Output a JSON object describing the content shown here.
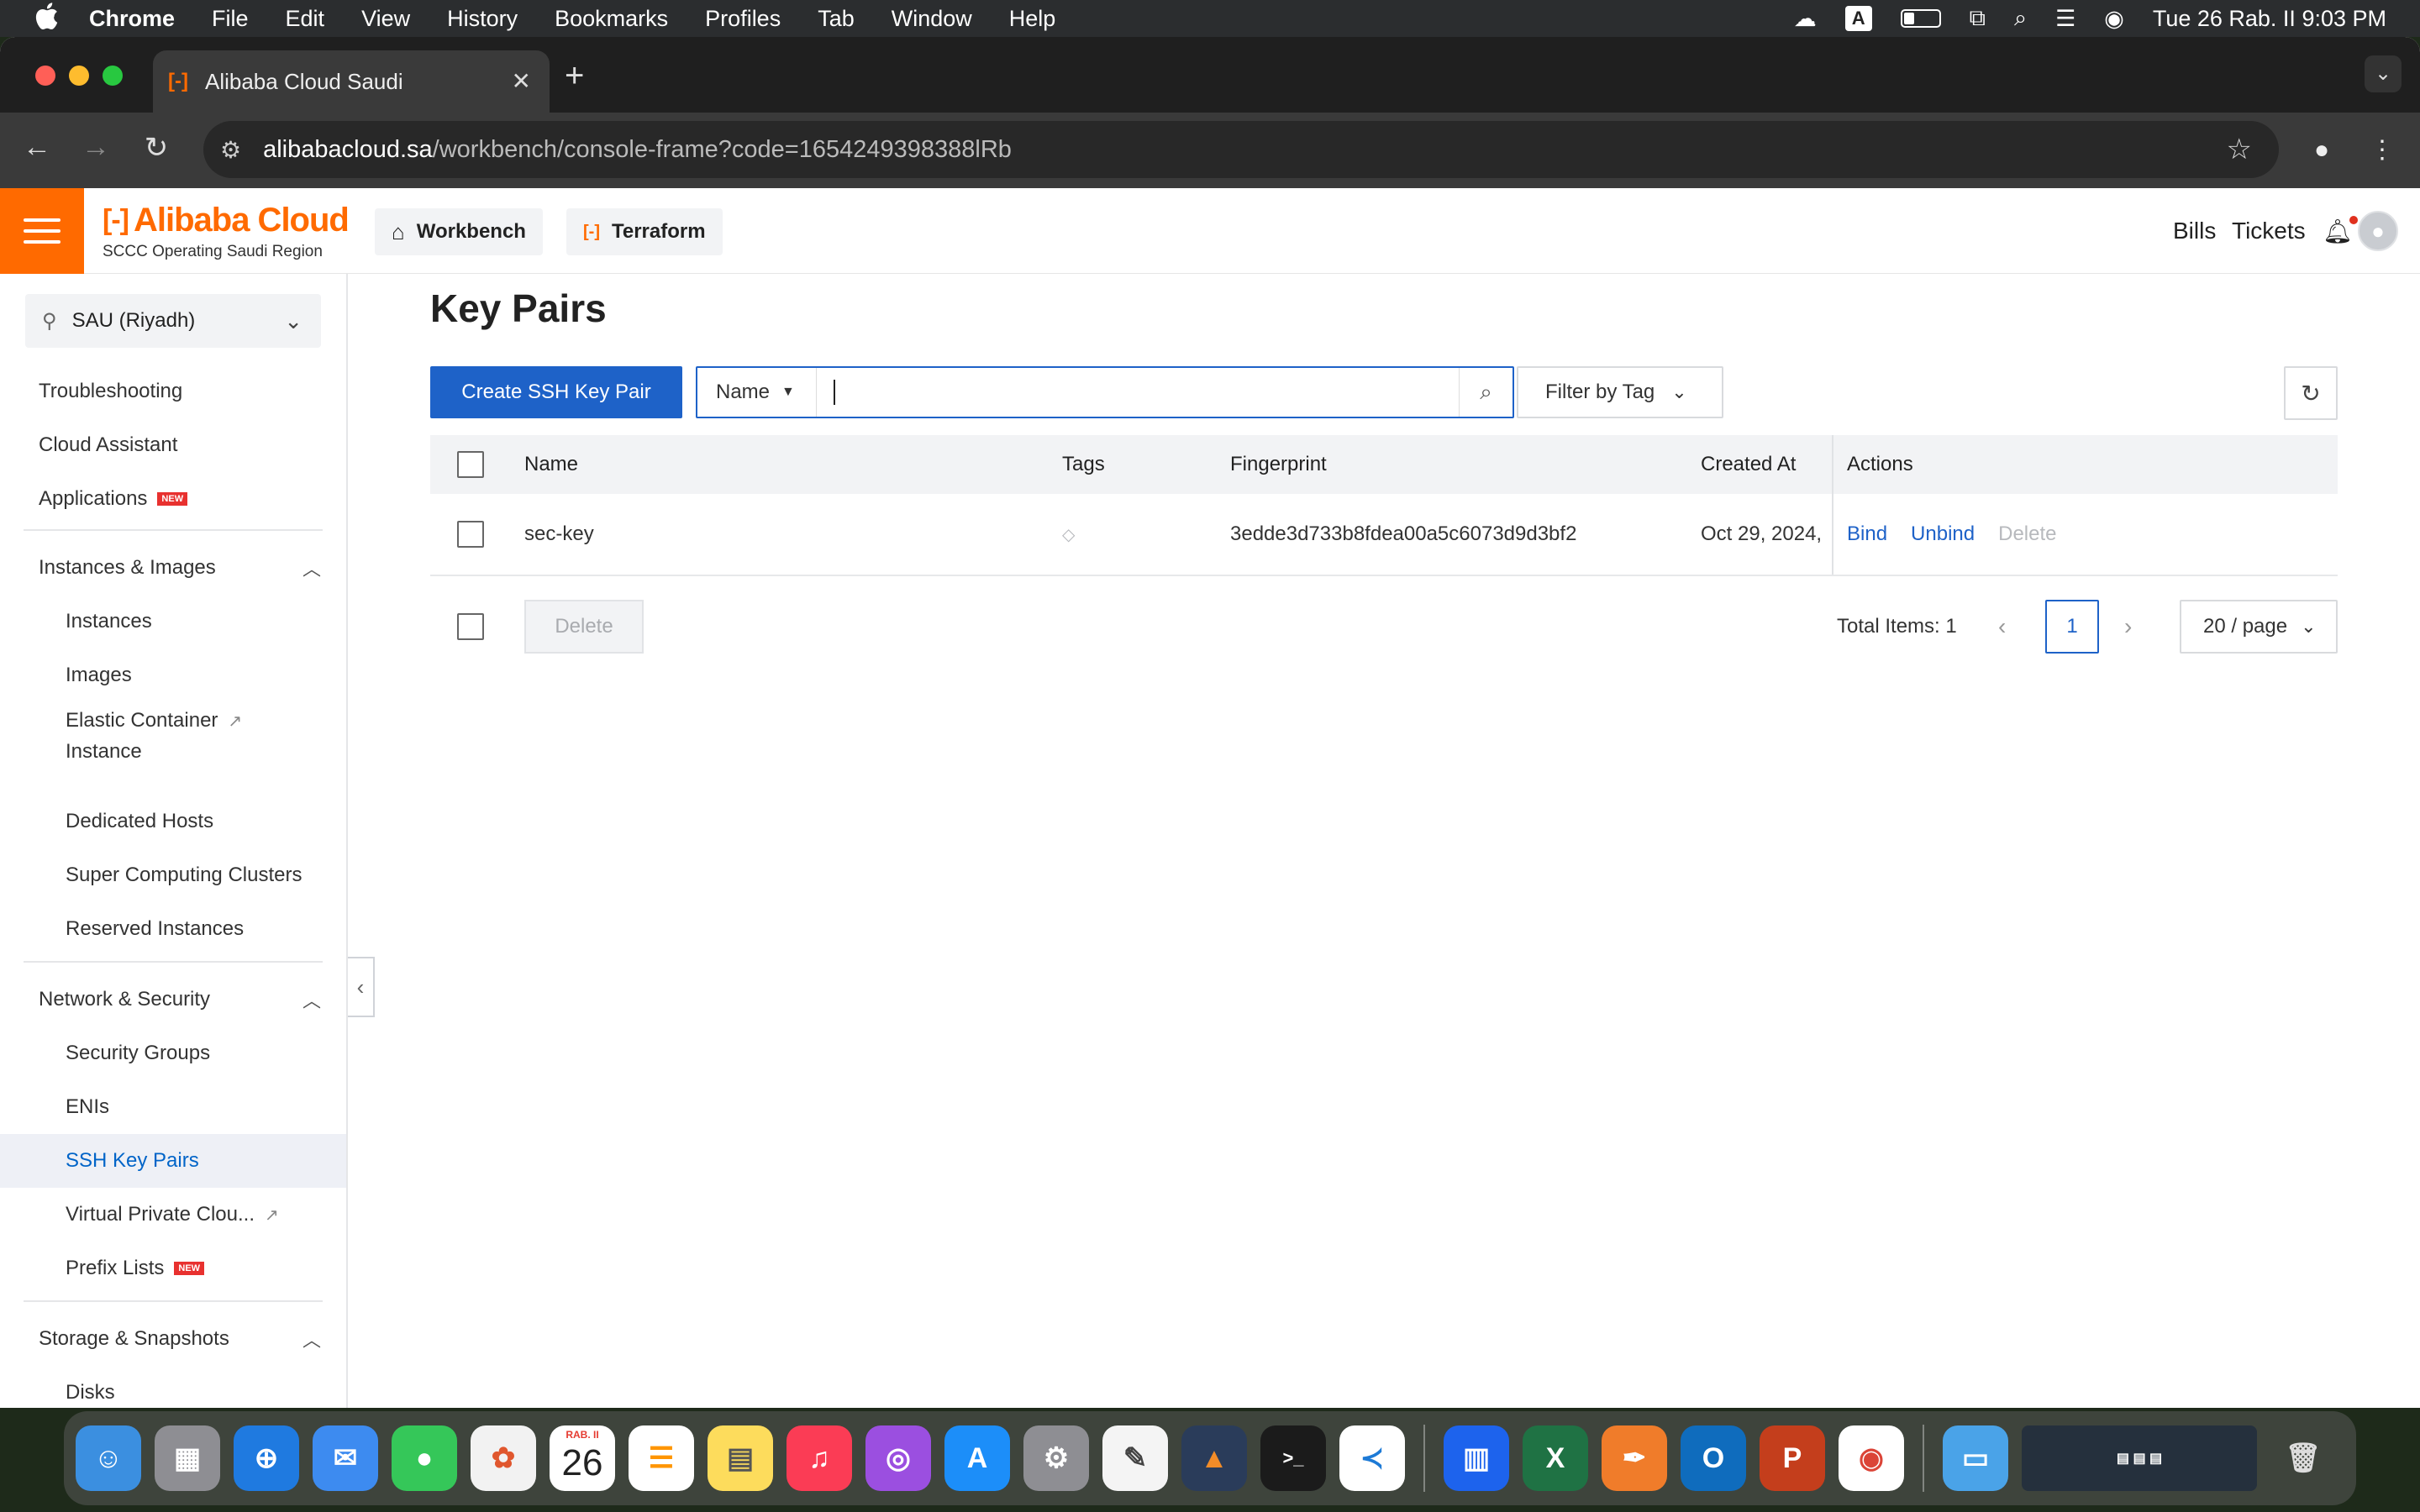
{
  "menubar": {
    "items": [
      "Chrome",
      "File",
      "Edit",
      "View",
      "History",
      "Bookmarks",
      "Profiles",
      "Tab",
      "Window",
      "Help"
    ],
    "input_source": "A",
    "clock": "Tue 26 Rab. II  9:03 PM"
  },
  "browser": {
    "tab_title": "Alibaba Cloud Saudi",
    "tab_favicon": "[-]",
    "url_host": "alibabacloud.sa",
    "url_path": "/workbench/console-frame?code=1654249398388lRb"
  },
  "console": {
    "logo_name": "Alibaba Cloud",
    "logo_bracket": "[-]",
    "logo_sub": "SCCC Operating Saudi Region",
    "workbench_label": "Workbench",
    "terraform_label": "Terraform",
    "bills_label": "Bills",
    "tickets_label": "Tickets",
    "accent_color": "#ff6a00"
  },
  "sidebar": {
    "region": "SAU (Riyadh)",
    "items": [
      {
        "label": "Troubleshooting"
      },
      {
        "label": "Cloud Assistant"
      },
      {
        "label": "Applications",
        "badge": "NEW"
      },
      {
        "label": "Instances & Images",
        "group": true
      },
      {
        "label": "Instances"
      },
      {
        "label": "Images"
      },
      {
        "label": "Elastic Container",
        "label2": "Instance",
        "external": true
      },
      {
        "label": "Dedicated Hosts"
      },
      {
        "label": "Super Computing Clusters"
      },
      {
        "label": "Reserved Instances"
      },
      {
        "label": "Network & Security",
        "group": true
      },
      {
        "label": "Security Groups"
      },
      {
        "label": "ENIs"
      },
      {
        "label": "SSH Key Pairs",
        "active": true
      },
      {
        "label": "Virtual Private Clou...",
        "external": true
      },
      {
        "label": "Prefix Lists",
        "badge": "NEW"
      },
      {
        "label": "Storage & Snapshots",
        "group": true
      },
      {
        "label": "Disks"
      }
    ]
  },
  "main": {
    "title": "Key Pairs",
    "create_button": "Create SSH Key Pair",
    "search_field": "Name",
    "search_value": "",
    "filter_tag": "Filter by Tag",
    "columns": {
      "name": "Name",
      "tags": "Tags",
      "fingerprint": "Fingerprint",
      "created": "Created At",
      "actions": "Actions"
    },
    "rows": [
      {
        "name": "sec-key",
        "fingerprint": "3edde3d733b8fdea00a5c6073d9d3bf2",
        "created": "Oct 29, 2024,",
        "actions": [
          "Bind",
          "Unbind",
          "Delete"
        ]
      }
    ],
    "delete_button": "Delete",
    "total_items": "Total Items: 1",
    "current_page": "1",
    "page_size": "20 / page"
  },
  "dock": {
    "calendar_month": "RAB. II",
    "calendar_day": "26",
    "apps": [
      "Finder",
      "Launchpad",
      "Safari",
      "Mail",
      "Messages",
      "Photos",
      "Calendar",
      "Reminders",
      "Notes",
      "Music",
      "Podcasts",
      "App Store",
      "System Settings",
      "TextEdit",
      "MATLAB",
      "Terminal",
      "Visual Studio Code",
      "Docker",
      "Excel",
      "Pages",
      "Outlook",
      "PowerPoint",
      "Chrome",
      "Downloads",
      "Trash"
    ]
  }
}
